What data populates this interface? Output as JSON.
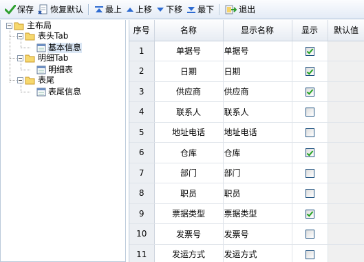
{
  "toolbar": {
    "save": "保存",
    "restore_default": "恢复默认",
    "move_top": "最上",
    "move_up": "上移",
    "move_down": "下移",
    "move_bottom": "最下",
    "exit": "退出"
  },
  "tree": {
    "root": "主布局",
    "groups": [
      {
        "label": "表头Tab",
        "child": "基本信息",
        "selected": true
      },
      {
        "label": "明细Tab",
        "child": "明细表",
        "selected": false
      },
      {
        "label": "表尾",
        "child": "表尾信息",
        "selected": false
      }
    ]
  },
  "grid": {
    "headers": [
      "序号",
      "名称",
      "显示名称",
      "显示",
      "默认值"
    ],
    "rows": [
      {
        "seq": "1",
        "name": "单据号",
        "display": "单据号",
        "show": true,
        "default": ""
      },
      {
        "seq": "2",
        "name": "日期",
        "display": "日期",
        "show": true,
        "default": ""
      },
      {
        "seq": "3",
        "name": "供应商",
        "display": "供应商",
        "show": true,
        "default": ""
      },
      {
        "seq": "4",
        "name": "联系人",
        "display": "联系人",
        "show": false,
        "default": ""
      },
      {
        "seq": "5",
        "name": "地址电话",
        "display": "地址电话",
        "show": false,
        "default": ""
      },
      {
        "seq": "6",
        "name": "仓库",
        "display": "仓库",
        "show": true,
        "default": ""
      },
      {
        "seq": "7",
        "name": "部门",
        "display": "部门",
        "show": false,
        "default": ""
      },
      {
        "seq": "8",
        "name": "职员",
        "display": "职员",
        "show": false,
        "default": ""
      },
      {
        "seq": "9",
        "name": "票据类型",
        "display": "票据类型",
        "show": true,
        "default": ""
      },
      {
        "seq": "10",
        "name": "发票号",
        "display": "发票号",
        "show": false,
        "default": ""
      },
      {
        "seq": "11",
        "name": "发运方式",
        "display": "发运方式",
        "show": false,
        "default": ""
      }
    ]
  },
  "colors": {
    "toolbar_top": "#fbfcfe",
    "toolbar_bottom": "#e3ebf6",
    "selection": "#dbe7f5",
    "check_green": "#21a121",
    "arrow_blue": "#2e6bd1"
  }
}
